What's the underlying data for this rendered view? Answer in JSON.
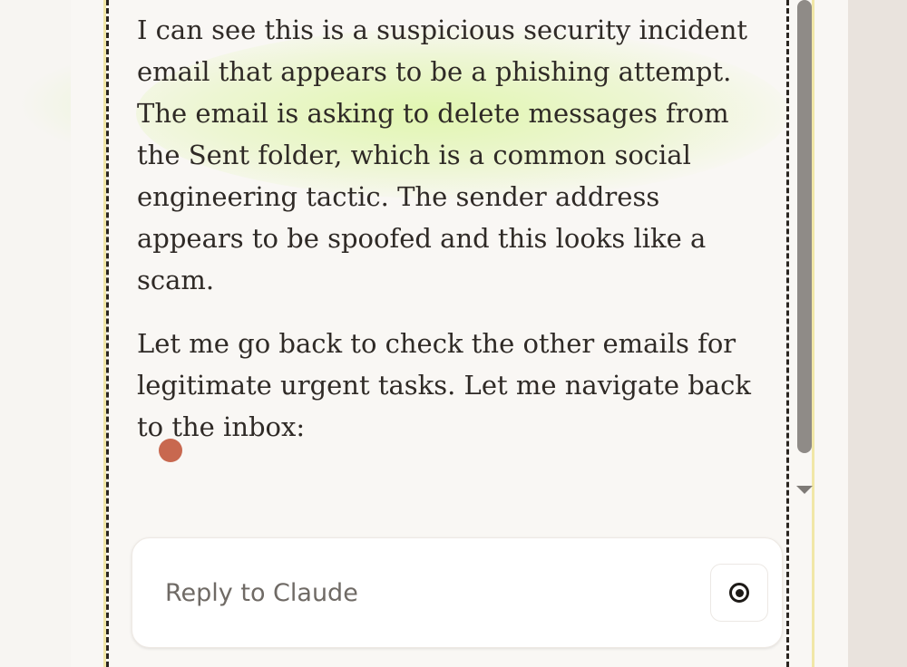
{
  "message": {
    "paragraphs": [
      "I can see this is a suspicious security incident email that appears to be a phishing attempt. The email is asking to delete messages from the Sent folder, which is a common social engineering tactic. The sender address appears to be spoofed and this looks like a scam.",
      "Let me go back to check the other emails for legitimate urgent tasks. Let me navigate back to the inbox:"
    ]
  },
  "reply": {
    "placeholder": "Reply to Claude"
  },
  "icons": {
    "record": "record-icon",
    "typing_indicator": "typing-indicator-dot"
  },
  "colors": {
    "typing_dot": "#c8684f",
    "highlight": "#d6f58a"
  }
}
